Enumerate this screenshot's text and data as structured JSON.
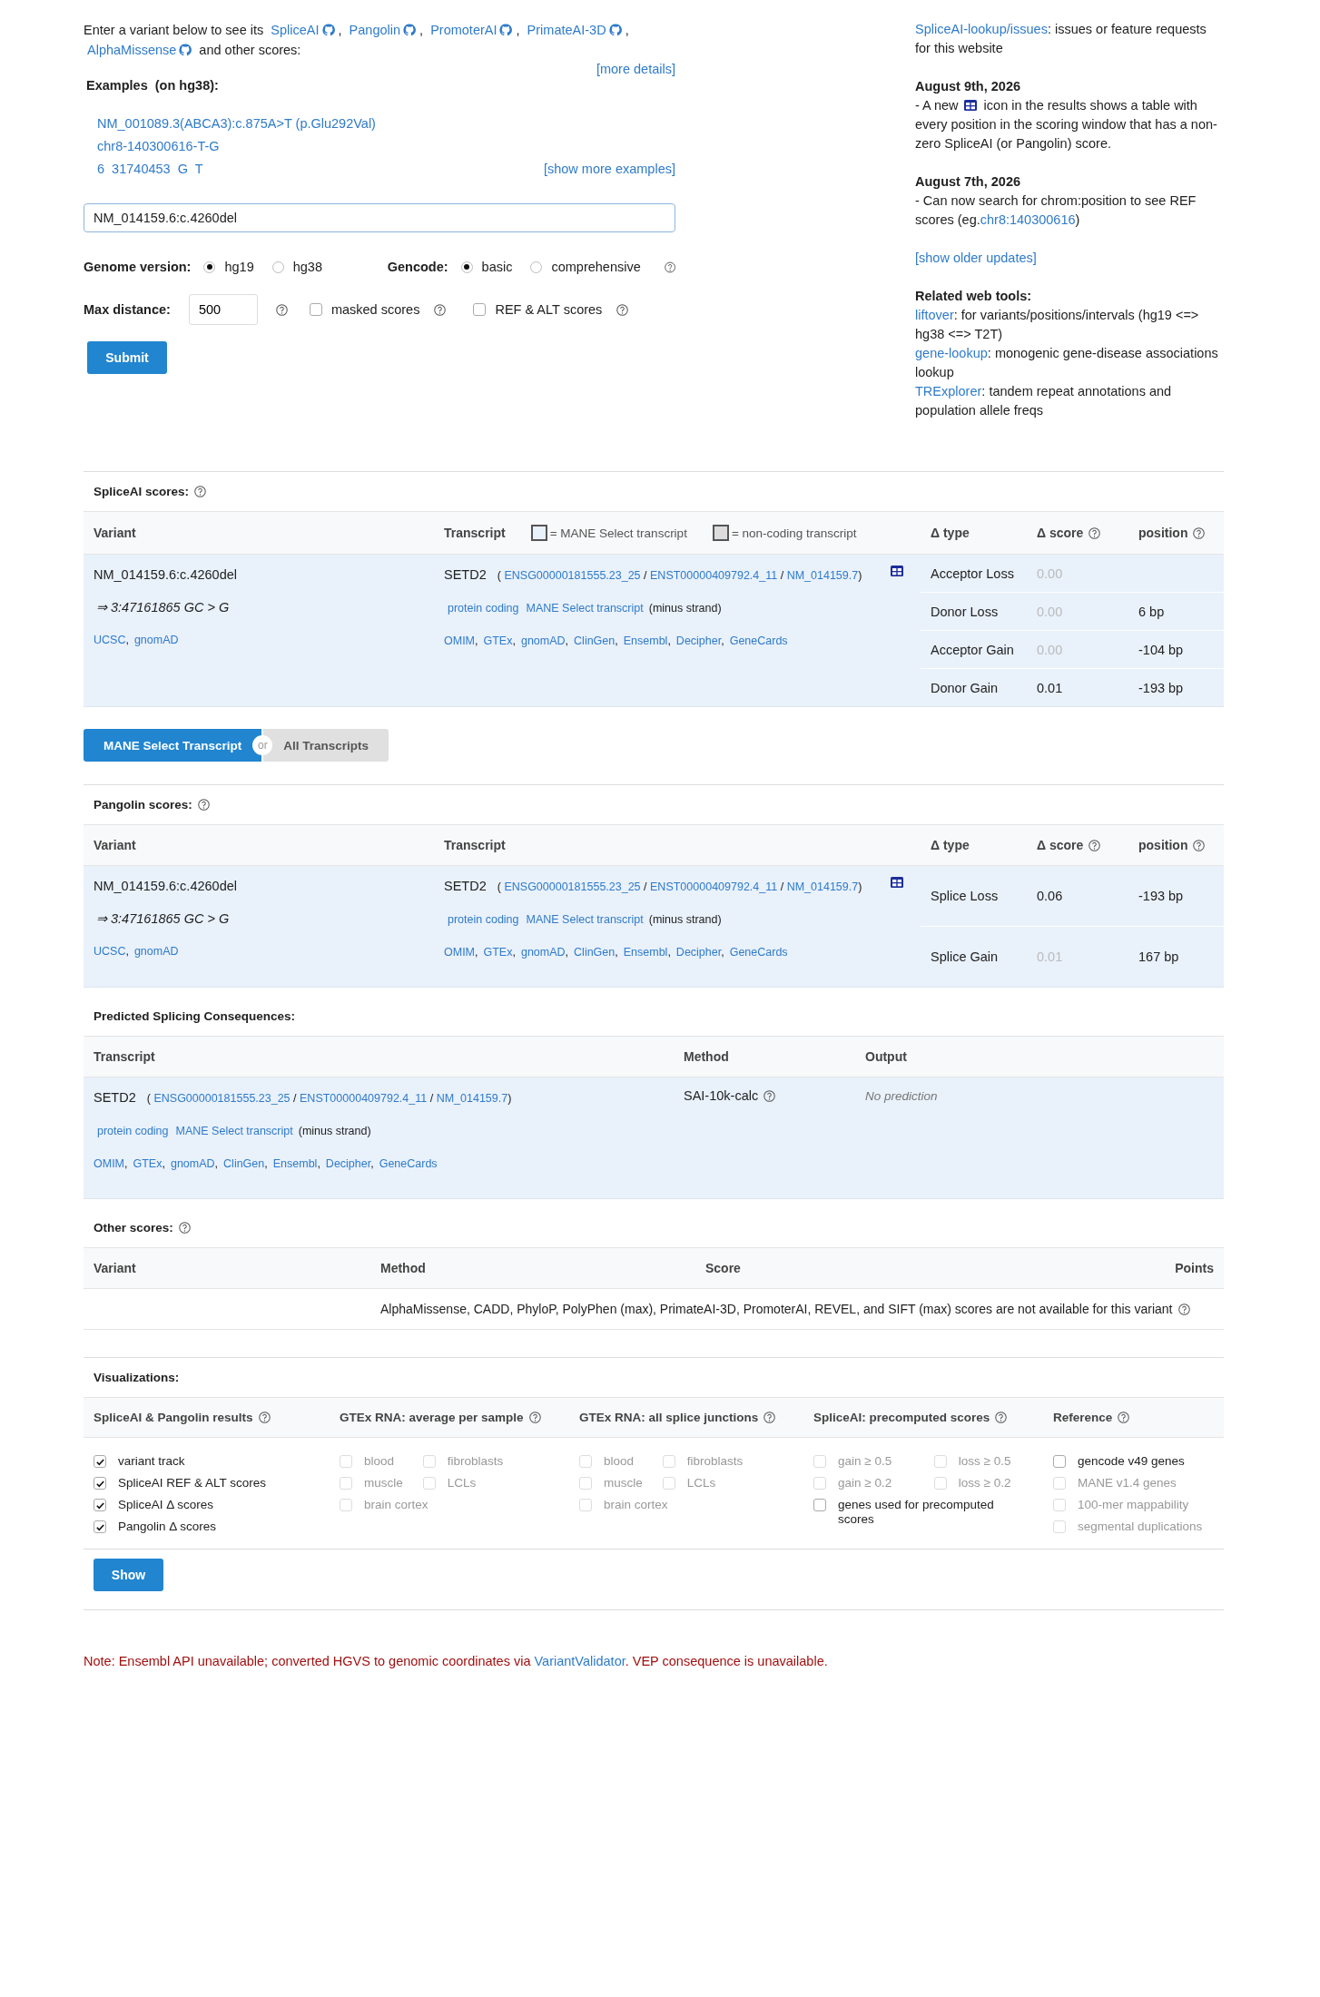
{
  "intro": {
    "lead": "Enter a variant below to see its",
    "tools": [
      {
        "label": "SpliceAI",
        "sep": ","
      },
      {
        "label": "Pangolin",
        "sep": ","
      },
      {
        "label": "PromoterAI",
        "sep": ","
      },
      {
        "label": "PrimateAI-3D",
        "sep": ","
      },
      {
        "label": "AlphaMissense"
      }
    ],
    "tail": "and other scores:"
  },
  "more_details": "[more details]",
  "examples": {
    "title": "Examples",
    "note": "(on hg38):",
    "items": [
      "NM_001089.3(ABCA3):c.875A>T (p.Glu292Val)",
      "chr8-140300616-T-G",
      "6  31740453  G  T"
    ],
    "more": "[show more examples]"
  },
  "variant_field": {
    "value": "NM_014159.6:c.4260del"
  },
  "genome": {
    "label": "Genome version:",
    "options": [
      {
        "label": "hg19",
        "selected": true
      },
      {
        "label": "hg38",
        "selected": false
      }
    ]
  },
  "gencode": {
    "label": "Gencode:",
    "help": true,
    "options": [
      {
        "label": "basic",
        "selected": true
      },
      {
        "label": "comprehensive",
        "selected": false
      }
    ]
  },
  "max_distance": {
    "label": "Max distance:",
    "value": "500",
    "help": true
  },
  "toggles": [
    {
      "label": "masked scores",
      "checked": false,
      "help": true
    },
    {
      "label": "REF & ALT scores",
      "checked": false,
      "help": true
    }
  ],
  "submit": "Submit",
  "sidebar": {
    "issues": {
      "link": "SpliceAI-lookup/issues",
      "text": ": issues or feature requests for this website"
    },
    "updates": [
      {
        "date": "August 9th, 2026",
        "segments": [
          {
            "kind": "text",
            "text": "- A new"
          },
          {
            "kind": "icon"
          },
          {
            "kind": "text",
            "text": "icon in the results shows a table with every position in the scoring window that has a non-zero SpliceAI (or Pangolin) score."
          }
        ]
      },
      {
        "date": "August 7th, 2026",
        "segments": [
          {
            "kind": "text",
            "text": "- Can now search for chrom:position to see REF scores (eg."
          },
          {
            "kind": "link",
            "text": "chr8:140300616"
          },
          {
            "kind": "text",
            "text": ")"
          }
        ]
      }
    ],
    "show_older": "[show older updates]",
    "related": {
      "title": "Related web tools:",
      "items": [
        {
          "link": "liftover",
          "text": ": for variants/positions/intervals (hg19 <=> hg38 <=> T2T)"
        },
        {
          "link": "gene-lookup",
          "text": ": monogenic gene-disease associations lookup"
        },
        {
          "link": "TRExplorer",
          "text": ": tandem repeat annotations and population allele freqs"
        }
      ]
    }
  },
  "spliceai": {
    "title": "SpliceAI scores:",
    "help": true,
    "columns": [
      {
        "label": "Variant"
      },
      {
        "label": "Transcript"
      },
      {
        "label": "Δ type"
      },
      {
        "label": "Δ score",
        "help": true
      },
      {
        "label": "position",
        "help": true
      }
    ],
    "legend": [
      {
        "label": "= MANE Select transcript",
        "color": "#e9f1fb"
      },
      {
        "label": "= non-coding transcript",
        "color": "#dddddd"
      }
    ],
    "row": {
      "variant": {
        "name": "NM_014159.6:c.4260del",
        "genomic": "⇒ 3:47161865 GC > G",
        "links": [
          {
            "label": "UCSC",
            "sep": ","
          },
          {
            "label": "gnomAD"
          }
        ]
      },
      "transcript": {
        "gene": "SETD2",
        "open": "(",
        "ids": [
          {
            "label": "ENSG00000181555.23_25",
            "sep": "/"
          },
          {
            "label": "ENST00000409792.4_11",
            "sep": "/"
          },
          {
            "label": "NM_014159.7"
          }
        ],
        "close": ")",
        "table_icon": true,
        "tags": [
          "protein coding",
          "MANE Select transcript"
        ],
        "strand": "(minus strand)",
        "links": [
          {
            "label": "OMIM",
            "sep": ","
          },
          {
            "label": "GTEx",
            "sep": ","
          },
          {
            "label": "gnomAD",
            "sep": ","
          },
          {
            "label": "ClinGen",
            "sep": ","
          },
          {
            "label": "Ensembl",
            "sep": ","
          },
          {
            "label": "Decipher",
            "sep": ","
          },
          {
            "label": "GeneCards"
          }
        ]
      },
      "scores": [
        {
          "type": "Acceptor Loss",
          "score": "0.00",
          "dimmed": true
        },
        {
          "type": "Donor Loss",
          "score": "0.00",
          "dimmed": true,
          "position": "6 bp"
        },
        {
          "type": "Acceptor Gain",
          "score": "0.00",
          "dimmed": true,
          "position": "-104 bp"
        },
        {
          "type": "Donor Gain",
          "score": "0.01",
          "dimmed": false,
          "position": "-193 bp"
        }
      ]
    }
  },
  "transcript_toggle": {
    "or": "or",
    "options": [
      {
        "label": "MANE Select Transcript",
        "selected": true
      },
      {
        "label": "All Transcripts",
        "selected": false
      }
    ]
  },
  "pangolin": {
    "title": "Pangolin scores:",
    "help": true,
    "columns": [
      {
        "label": "Variant"
      },
      {
        "label": "Transcript"
      },
      {
        "label": "Δ type"
      },
      {
        "label": "Δ score",
        "help": true
      },
      {
        "label": "position",
        "help": true
      }
    ],
    "row": {
      "variant": {
        "name": "NM_014159.6:c.4260del",
        "genomic": "⇒ 3:47161865 GC > G",
        "links": [
          {
            "label": "UCSC",
            "sep": ","
          },
          {
            "label": "gnomAD"
          }
        ]
      },
      "transcript": {
        "gene": "SETD2",
        "open": "(",
        "ids": [
          {
            "label": "ENSG00000181555.23_25",
            "sep": "/"
          },
          {
            "label": "ENST00000409792.4_11",
            "sep": "/"
          },
          {
            "label": "NM_014159.7"
          }
        ],
        "close": ")",
        "table_icon": true,
        "tags": [
          "protein coding",
          "MANE Select transcript"
        ],
        "strand": "(minus strand)",
        "links": [
          {
            "label": "OMIM",
            "sep": ","
          },
          {
            "label": "GTEx",
            "sep": ","
          },
          {
            "label": "gnomAD",
            "sep": ","
          },
          {
            "label": "ClinGen",
            "sep": ","
          },
          {
            "label": "Ensembl",
            "sep": ","
          },
          {
            "label": "Decipher",
            "sep": ","
          },
          {
            "label": "GeneCards"
          }
        ]
      },
      "scores": [
        {
          "type": "Splice Loss",
          "score": "0.06",
          "dimmed": false,
          "position": "-193 bp"
        },
        {
          "type": "Splice Gain",
          "score": "0.01",
          "dimmed": true,
          "position": "167 bp"
        }
      ]
    }
  },
  "consequences": {
    "title": "Predicted Splicing Consequences:",
    "columns": [
      "Transcript",
      "Method",
      "Output"
    ],
    "row": {
      "transcript": {
        "gene": "SETD2",
        "open": "(",
        "ids": [
          {
            "label": "ENSG00000181555.23_25",
            "sep": "/"
          },
          {
            "label": "ENST00000409792.4_11",
            "sep": "/"
          },
          {
            "label": "NM_014159.7"
          }
        ],
        "close": ")",
        "tags": [
          "protein coding",
          "MANE Select transcript"
        ],
        "strand": "(minus strand)",
        "links": [
          {
            "label": "OMIM",
            "sep": ","
          },
          {
            "label": "GTEx",
            "sep": ","
          },
          {
            "label": "gnomAD",
            "sep": ","
          },
          {
            "label": "ClinGen",
            "sep": ","
          },
          {
            "label": "Ensembl",
            "sep": ","
          },
          {
            "label": "Decipher",
            "sep": ","
          },
          {
            "label": "GeneCards"
          }
        ]
      },
      "method": "SAI-10k-calc",
      "method_help": true,
      "output": "No prediction"
    }
  },
  "other_scores": {
    "title": "Other scores:",
    "help": true,
    "columns": [
      "Variant",
      "Method",
      "Score",
      "Points"
    ],
    "message": "AlphaMissense, CADD, PhyloP, PolyPhen (max), PrimateAI-3D, PromoterAI, REVEL, and SIFT (max) scores are not available for this variant",
    "message_help": true
  },
  "visualizations": {
    "title": "Visualizations:",
    "groups": [
      {
        "title": "SpliceAI & Pangolin results",
        "kind": "list",
        "options": [
          {
            "label": "variant track",
            "checked": true,
            "disabled": false
          },
          {
            "label": "SpliceAI REF & ALT scores",
            "checked": true,
            "disabled": false
          },
          {
            "label": "SpliceAI Δ  scores",
            "checked": true,
            "disabled": false
          },
          {
            "label": "Pangolin Δ  scores",
            "checked": true,
            "disabled": false
          }
        ]
      },
      {
        "title": "GTEx RNA: average per sample",
        "kind": "grid",
        "options": [
          {
            "label": "blood",
            "checked": false,
            "disabled": true
          },
          {
            "label": "fibroblasts",
            "checked": false,
            "disabled": true
          },
          {
            "label": "muscle",
            "checked": false,
            "disabled": true
          },
          {
            "label": "LCLs",
            "checked": false,
            "disabled": true
          },
          {
            "label": "brain cortex",
            "checked": false,
            "disabled": true
          }
        ]
      },
      {
        "title": "GTEx RNA: all splice junctions",
        "kind": "grid",
        "options": [
          {
            "label": "blood",
            "checked": false,
            "disabled": true
          },
          {
            "label": "fibroblasts",
            "checked": false,
            "disabled": true
          },
          {
            "label": "muscle",
            "checked": false,
            "disabled": true
          },
          {
            "label": "LCLs",
            "checked": false,
            "disabled": true
          },
          {
            "label": "brain cortex",
            "checked": false,
            "disabled": true
          }
        ]
      },
      {
        "title": "SpliceAI: precomputed scores",
        "kind": "grid",
        "options": [
          {
            "label": "gain ≥ 0.5",
            "checked": false,
            "disabled": true
          },
          {
            "label": "loss ≥ 0.5",
            "checked": false,
            "disabled": true
          },
          {
            "label": "gain ≥ 0.2",
            "checked": false,
            "disabled": true
          },
          {
            "label": "loss ≥ 0.2",
            "checked": false,
            "disabled": true
          },
          {
            "label": "genes used for precomputed scores",
            "checked": false,
            "disabled": false
          }
        ]
      },
      {
        "title": "Reference",
        "kind": "list",
        "options": [
          {
            "label": "gencode v49 genes",
            "checked": false,
            "disabled": false
          },
          {
            "label": "MANE v1.4 genes",
            "checked": false,
            "disabled": true
          },
          {
            "label": "100-mer mappability",
            "checked": false,
            "disabled": true
          },
          {
            "label": "segmental duplications",
            "checked": false,
            "disabled": true
          }
        ]
      }
    ],
    "show": "Show"
  },
  "note": {
    "before": "Note: Ensembl API unavailable; converted HGVS to genomic coordinates via",
    "link": "VariantValidator",
    "after": ". VEP consequence is unavailable."
  }
}
